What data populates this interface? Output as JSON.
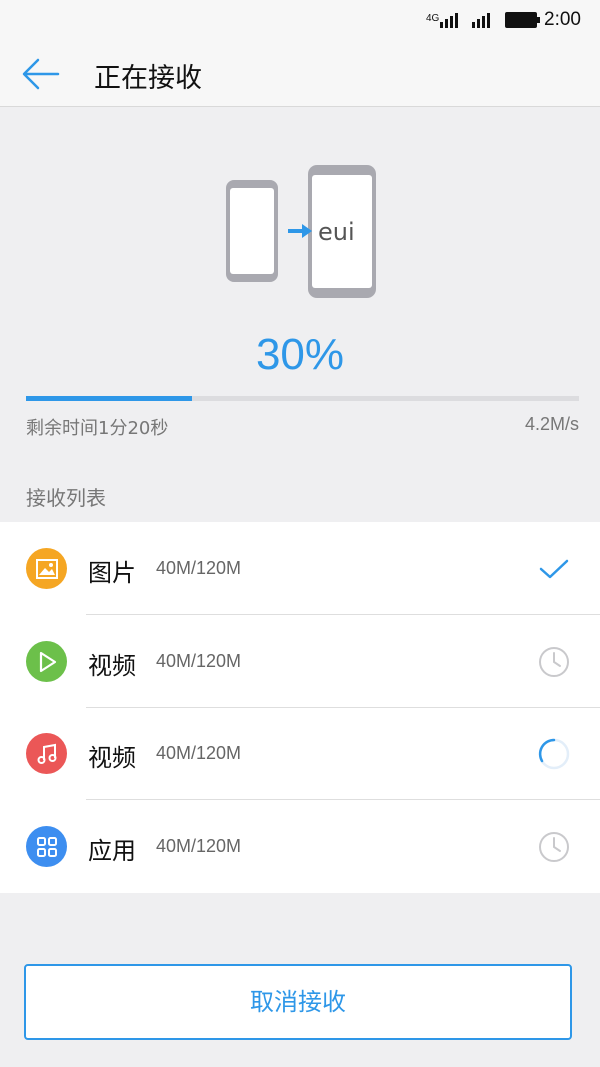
{
  "status_bar": {
    "network": "4G",
    "time": "2:00"
  },
  "header": {
    "title": "正在接收"
  },
  "illustration": {
    "brand_text": "eui"
  },
  "transfer": {
    "percent_label": "30%",
    "progress": 0.3,
    "remaining": "剩余时间1分20秒",
    "speed": "4.2M/s"
  },
  "list": {
    "title": "接收列表",
    "items": [
      {
        "name": "图片",
        "size": "40M/120M",
        "icon": "image-icon",
        "color": "#f5a623",
        "state": "done"
      },
      {
        "name": "视频",
        "size": "40M/120M",
        "icon": "play-icon",
        "color": "#6cc04a",
        "state": "waiting"
      },
      {
        "name": "视频",
        "size": "40M/120M",
        "icon": "music-icon",
        "color": "#eb5757",
        "state": "in-progress"
      },
      {
        "name": "应用",
        "size": "40M/120M",
        "icon": "apps-grid-icon",
        "color": "#3d8ef0",
        "state": "waiting"
      }
    ]
  },
  "actions": {
    "cancel_label": "取消接收"
  },
  "colors": {
    "accent": "#2e97e8",
    "background": "#efeff1"
  }
}
